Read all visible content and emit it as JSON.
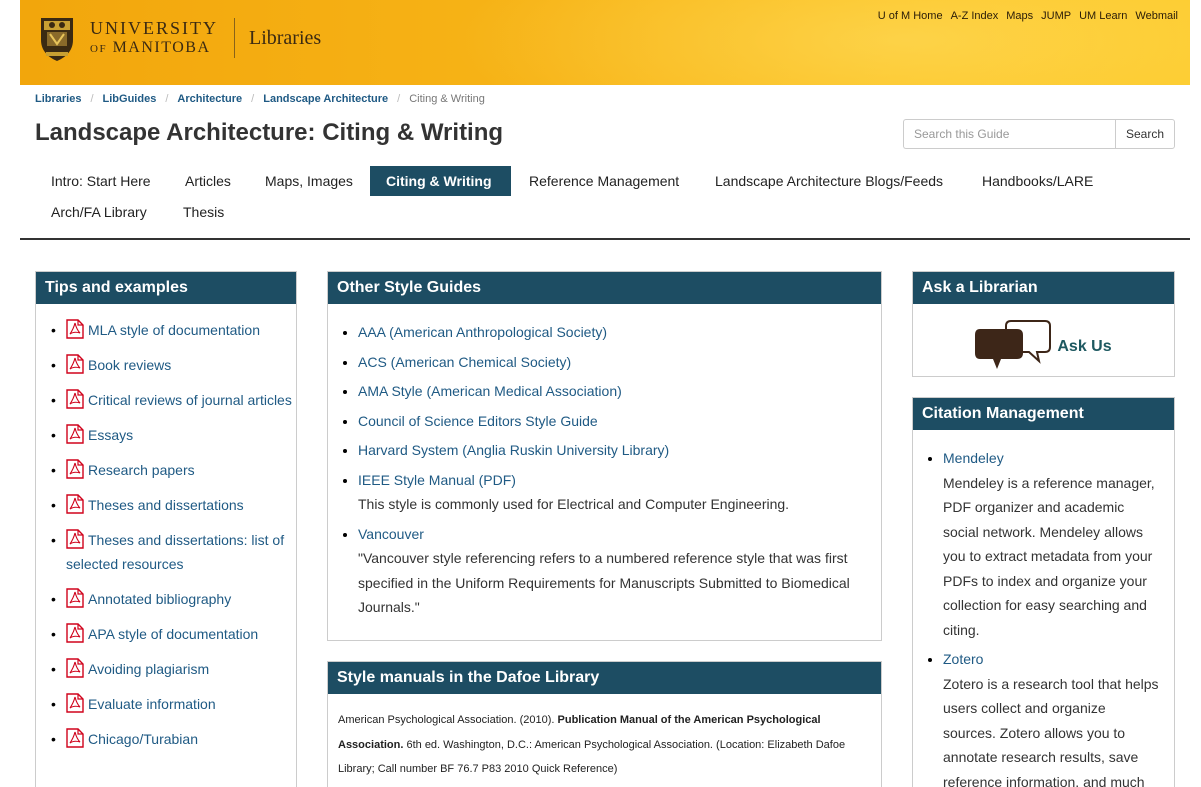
{
  "header": {
    "university_line1": "UNIVERSITY",
    "university_of": "OF",
    "university_line2": "MANITOBA",
    "libraries": "Libraries",
    "top_links": [
      "U of M Home",
      "A-Z Index",
      "Maps",
      "JUMP",
      "UM Learn",
      "Webmail"
    ]
  },
  "breadcrumb": {
    "items": [
      "Libraries",
      "LibGuides",
      "Architecture",
      "Landscape Architecture"
    ],
    "current": "Citing & Writing"
  },
  "page_title": "Landscape Architecture: Citing & Writing",
  "search": {
    "placeholder": "Search this Guide",
    "button": "Search"
  },
  "tabs": [
    "Intro: Start Here",
    "Articles",
    "Maps, Images",
    "Citing & Writing",
    "Reference Management",
    "Landscape Architecture Blogs/Feeds",
    "Handbooks/LARE",
    "Arch/FA Library",
    "Thesis"
  ],
  "active_tab": "Citing & Writing",
  "tips": {
    "title": "Tips and examples",
    "items": [
      "MLA style of documentation",
      "Book reviews",
      "Critical reviews of journal articles",
      "Essays",
      "Research papers",
      "Theses and dissertations",
      "Theses and dissertations: list of selected resources",
      "Annotated bibliography",
      "APA style of documentation",
      "Avoiding plagiarism",
      "Evaluate information",
      "Chicago/Turabian"
    ]
  },
  "other_guides": {
    "title": "Other Style Guides",
    "items": [
      {
        "link": "AAA (American Anthropological Society)",
        "desc": ""
      },
      {
        "link": "ACS (American Chemical Society)",
        "desc": ""
      },
      {
        "link": "AMA Style (American Medical Association)",
        "desc": ""
      },
      {
        "link": "Council of Science Editors Style Guide",
        "desc": ""
      },
      {
        "link": "Harvard System (Anglia Ruskin University Library)",
        "desc": ""
      },
      {
        "link": "IEEE Style Manual (PDF)",
        "desc": "This style is commonly used for Electrical and Computer Engineering."
      },
      {
        "link": "Vancouver",
        "desc": "\"Vancouver style referencing refers to a numbered reference style that was first specified in the Uniform Requirements for Manuscripts Submitted to Biomedical Journals.\""
      }
    ]
  },
  "dafoe": {
    "title": "Style manuals in the Dafoe Library",
    "author": "American Psychological Association. (2010).",
    "book_title": "Publication Manual of the American Psychological Association.",
    "details": "6th ed. Washington, D.C.: American Psychological Association. (Location: Elizabeth Dafoe Library; Call number BF 76.7 P83 2010 Quick Reference)"
  },
  "ask": {
    "title": "Ask a Librarian",
    "link": "Ask Us"
  },
  "citation_mgmt": {
    "title": "Citation Management",
    "items": [
      {
        "link": "Mendeley",
        "desc": "Mendeley is a reference manager, PDF organizer and academic social network. Mendeley allows you to extract metadata from your PDFs to index and organize your collection for easy searching and citing."
      },
      {
        "link": "Zotero",
        "desc": "Zotero is a research tool that helps users collect and organize sources. Zotero allows you to annotate research results, save reference information, and much"
      }
    ]
  },
  "colors": {
    "header_orange": "#f7b417",
    "box_header": "#1d4d63",
    "link": "#1f5a84",
    "pdf_red": "#d0021b"
  }
}
